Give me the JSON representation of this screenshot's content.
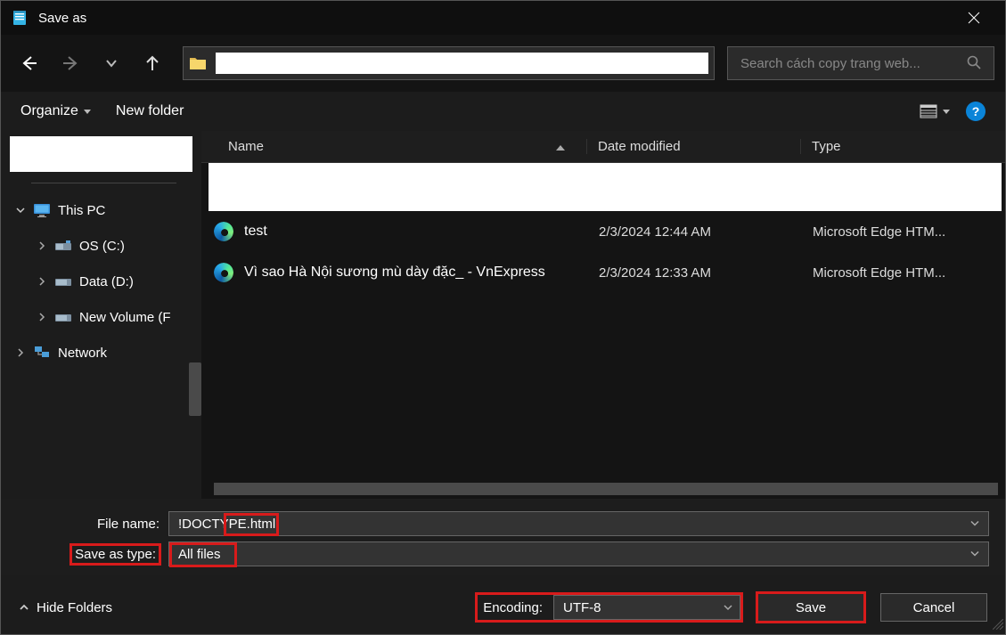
{
  "window": {
    "title": "Save as"
  },
  "search": {
    "placeholder": "Search cách copy trang web..."
  },
  "toolbar": {
    "organize": "Organize",
    "new_folder": "New folder",
    "help": "?"
  },
  "sidebar": {
    "this_pc": "This PC",
    "items": [
      {
        "label": "OS (C:)"
      },
      {
        "label": "Data (D:)"
      },
      {
        "label": "New Volume (F"
      }
    ],
    "network": "Network"
  },
  "columns": {
    "name": "Name",
    "date": "Date modified",
    "type": "Type"
  },
  "rows": [
    {
      "name": "test",
      "date": "2/3/2024 12:44 AM",
      "type": "Microsoft Edge HTM..."
    },
    {
      "name": "Vì sao Hà Nội sương mù dày đặc_ - VnExpress",
      "date": "2/3/2024 12:33 AM",
      "type": "Microsoft Edge HTM..."
    }
  ],
  "form": {
    "file_name_label": "File name:",
    "file_name_value": "!DOCTYPE.html",
    "save_type_label": "Save as type:",
    "save_type_value": "All files"
  },
  "encoding": {
    "label": "Encoding:",
    "value": "UTF-8"
  },
  "buttons": {
    "save": "Save",
    "cancel": "Cancel",
    "hide_folders": "Hide Folders"
  }
}
